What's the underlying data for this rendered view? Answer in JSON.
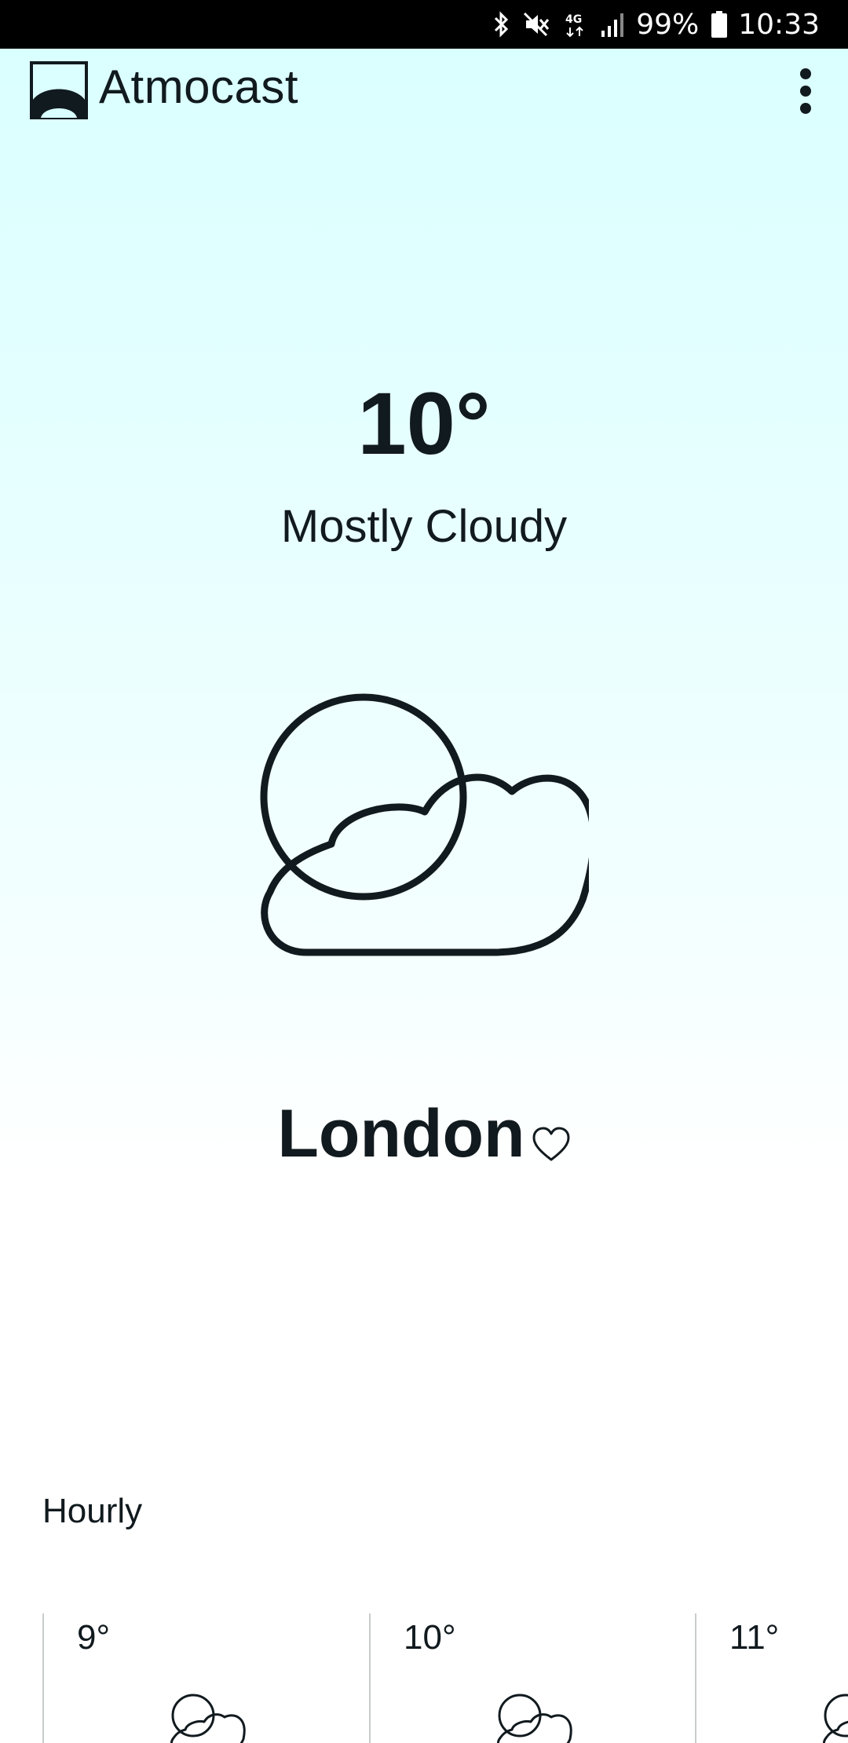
{
  "status_bar": {
    "battery": "99%",
    "time": "10:33",
    "network": "4G"
  },
  "app": {
    "title": "Atmocast",
    "logo_icon": "sunrise-logo-icon",
    "menu_icon": "more-vert-icon"
  },
  "current": {
    "temperature": "10°",
    "condition": "Mostly Cloudy",
    "icon": "partly-cloudy-icon",
    "city": "London",
    "favorite_icon": "heart-outline-icon"
  },
  "hourly": {
    "label": "Hourly",
    "items": [
      {
        "temp": "9°",
        "icon": "partly-cloudy-icon"
      },
      {
        "temp": "10°",
        "icon": "partly-cloudy-icon"
      },
      {
        "temp": "11°",
        "icon": "partly-cloudy-icon"
      }
    ]
  },
  "colors": {
    "background_top": "#d9ffff",
    "background_bottom": "#ffffff",
    "text": "#111a1e",
    "status_bar": "#000000"
  }
}
